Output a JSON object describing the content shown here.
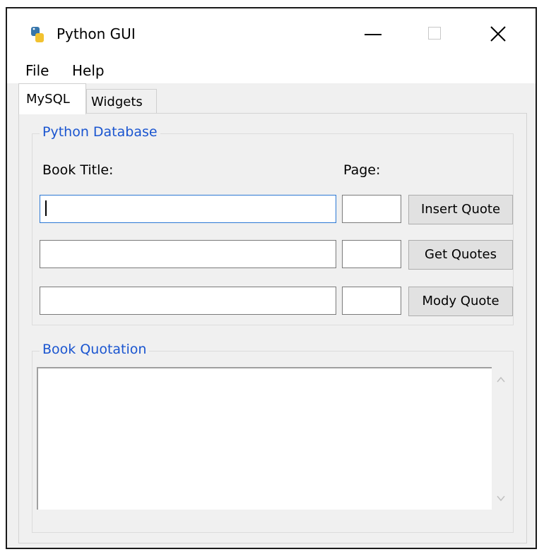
{
  "window": {
    "title": "Python GUI"
  },
  "menu": {
    "file": "File",
    "help": "Help"
  },
  "tabs": [
    {
      "label": "MySQL"
    },
    {
      "label": "Widgets"
    }
  ],
  "database_group": {
    "legend": "Python Database",
    "book_title_label": "Book Title:",
    "page_label": "Page:",
    "rows": [
      {
        "title": "",
        "page": "",
        "button": "Insert Quote"
      },
      {
        "title": "",
        "page": "",
        "button": "Get Quotes"
      },
      {
        "title": "",
        "page": "",
        "button": "Mody Quote"
      }
    ]
  },
  "quotation_group": {
    "legend": "Book Quotation",
    "text": ""
  },
  "icons": {
    "app": "python-icon",
    "minimize": "minimize-icon",
    "maximize": "maximize-icon",
    "close": "close-icon",
    "scroll_up": "chevron-up-icon",
    "scroll_down": "chevron-down-icon"
  },
  "colors": {
    "group_legend": "#1a55d0",
    "focus_border": "#2b78d4",
    "window_bg": "#f0f0f0"
  }
}
